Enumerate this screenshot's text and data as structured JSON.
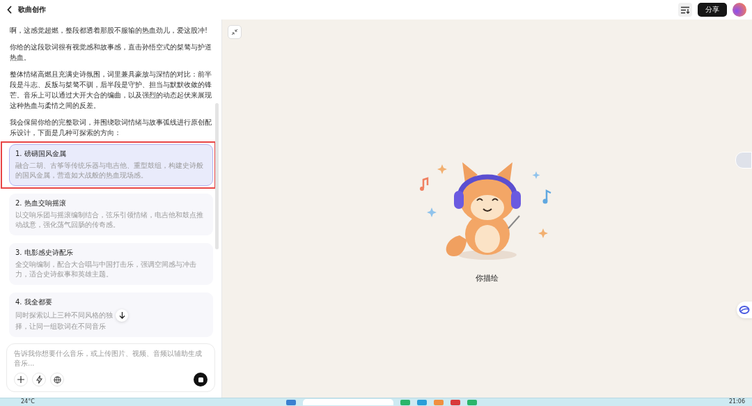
{
  "header": {
    "title": "歌曲创作",
    "share_label": "分享"
  },
  "chat": {
    "paragraphs": [
      "啊，这感觉超燃，整段都透着那股不服输的热血劲儿，爱这股冲!",
      "你给的这段歌词很有视觉感和故事感，直击孙悟空式的桀骜与护道热血。",
      "整体情绪高燃且充满史诗氛围，词里兼具豪放与深情的对比：前半段是斗志、反叛与桀骜不驯，后半段是守护、担当与默默收敛的锋芒。音乐上可以通过大开大合的编曲，以及强烈的动态起伏来展现这种热血与柔情之间的反差。",
      "我会保留你给的完整歌词，并围绕歌词情绪与故事弧线进行原创配乐设计，下面是几种可探索的方向："
    ],
    "options": [
      {
        "title": "1. 磅礴国风金属",
        "description": [
          "融合二胡、古筝等传统乐器与电吉他、重型鼓组，构建史诗般的国风金属，营造如大战般的热血现场感。"
        ],
        "selected": true,
        "highlighted": true
      },
      {
        "title": "2. 热血交响摇滚",
        "description": [
          "以交响乐团与摇滚编制结合，弦乐引领情绪，电吉他和鼓点推动战意，强化荡气回肠的传奇感。"
        ],
        "selected": false,
        "highlighted": false
      },
      {
        "title": "3. 电影感史诗配乐",
        "description": [
          "全交响编制，配合大合唱与中国打击乐，强调空间感与冲击力，适合史诗叙事和英雄主题。"
        ],
        "selected": false,
        "highlighted": false
      },
      {
        "title": "4. 我全都要",
        "description": [
          "同时探索以上三种不同风格的独",
          "择，让同一组歌词在不同音乐"
        ],
        "selected": false,
        "highlighted": false
      }
    ]
  },
  "composer": {
    "placeholder": "告诉我你想要什么音乐，或上传图片、视频、音频以辅助生成音乐..."
  },
  "canvas": {
    "caption": "你描绘"
  },
  "taskbar": {
    "weather": "24°C",
    "clock": "21:06"
  }
}
